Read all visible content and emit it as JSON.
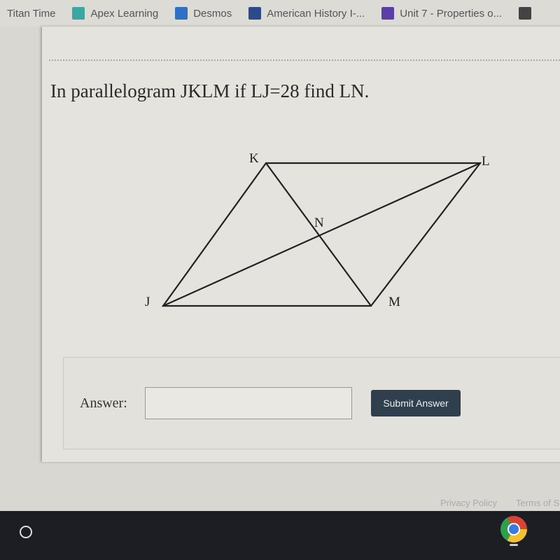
{
  "bookmarks": [
    {
      "label": "Titan Time",
      "icon": "none"
    },
    {
      "label": "Apex Learning",
      "icon": "apex-icon",
      "color": "#3aa7a0"
    },
    {
      "label": "Desmos",
      "icon": "desmos-icon",
      "color": "#2f6fc4"
    },
    {
      "label": "American History I-...",
      "icon": "book-icon",
      "color": "#2b4a8a"
    },
    {
      "label": "Unit 7 - Properties o...",
      "icon": "forms-icon",
      "color": "#5b3fa6"
    }
  ],
  "question": "In parallelogram JKLM if LJ=28 find LN.",
  "figure": {
    "labels": {
      "K": "K",
      "L": "L",
      "J": "J",
      "M": "M",
      "N": "N"
    }
  },
  "answer": {
    "label": "Answer:",
    "value": "",
    "submit_label": "Submit Answer"
  },
  "footer": {
    "privacy": "Privacy Policy",
    "terms": "Terms of S"
  }
}
